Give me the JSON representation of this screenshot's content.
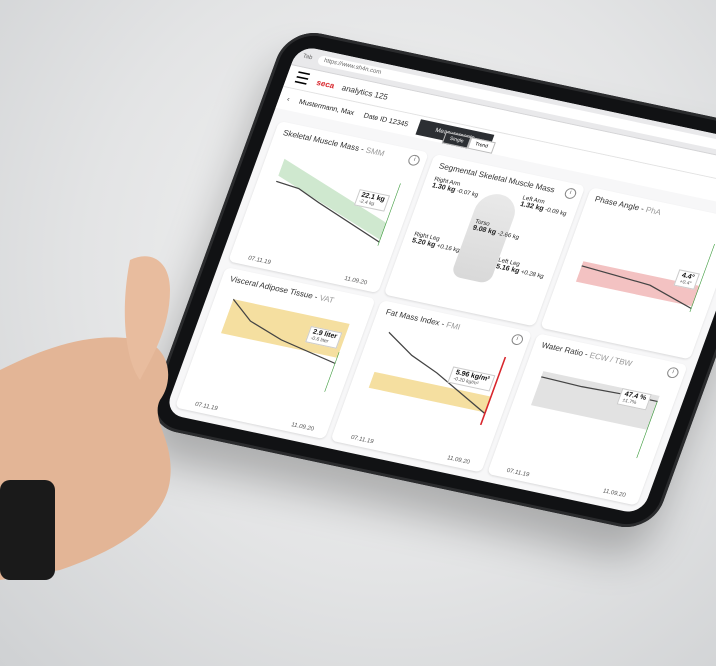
{
  "browser": {
    "url": "https://www.sh4n.com",
    "tab": "Tab"
  },
  "app": {
    "brand": "seca",
    "name": "analytics 125",
    "menu_label": "Measurements"
  },
  "patient": {
    "name": "Mustermann, Max",
    "id": "Date ID 12345"
  },
  "toggle": [
    "Single",
    "Trend"
  ],
  "cards": [
    {
      "title": "Skeletal Muscle Mass",
      "abbr": "SMM",
      "value": "22.1 kg",
      "delta": "-2.4 kg",
      "start_date": "07.11.19",
      "end_date": "11.09.20"
    },
    {
      "title": "Segmental Skeletal Muscle Mass",
      "abbr": "",
      "segments": [
        {
          "label": "Right Arm",
          "value": "1.30 kg",
          "delta": "-0.07 kg"
        },
        {
          "label": "Left Arm",
          "value": "1.32 kg",
          "delta": "-0.09 kg"
        },
        {
          "label": "Torso",
          "value": "9.08 kg",
          "delta": "-2.66 kg"
        },
        {
          "label": "Right Leg",
          "value": "5.20 kg",
          "delta": "+0.16 kg"
        },
        {
          "label": "Left Leg",
          "value": "5.16 kg",
          "delta": "+0.28 kg"
        }
      ]
    },
    {
      "title": "Phase Angle",
      "abbr": "PhA",
      "value": "4.4°",
      "delta": "+0.4°",
      "start_date": "",
      "end_date": ""
    },
    {
      "title": "Visceral Adipose Tissue",
      "abbr": "VAT",
      "value": "2.9 liter",
      "delta": "-0.6 liter",
      "start_date": "07.11.19",
      "end_date": "11.09.20"
    },
    {
      "title": "Fat Mass Index",
      "abbr": "FMI",
      "value": "5.96 kg/m²",
      "delta": "-0.20 kg/m²",
      "start_date": "07.11.19",
      "end_date": "11.09.20"
    },
    {
      "title": "Water Ratio",
      "abbr": "ECW / TBW",
      "value": "47.4 %",
      "delta": "±1.7%",
      "start_date": "07.11.19",
      "end_date": "11.09.20"
    }
  ],
  "colors": {
    "brand": "#d8262c",
    "green": "#3a9a3a",
    "red_band": "#f3c2c2",
    "green_band": "#cfe8cf",
    "yellow_band": "#f5dfa0"
  }
}
